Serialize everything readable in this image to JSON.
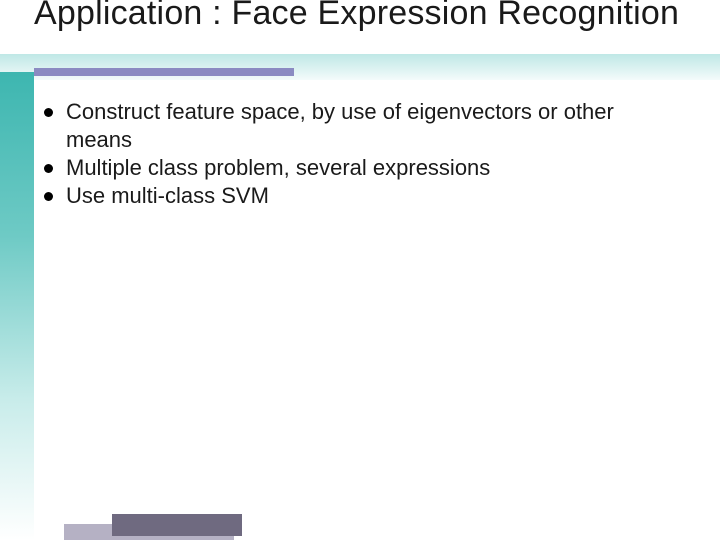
{
  "title": "Application : Face Expression Recognition",
  "bullets": [
    "Construct feature space, by use of eigenvectors or other means",
    "Multiple class problem, several expressions",
    "Use multi-class SVM"
  ]
}
